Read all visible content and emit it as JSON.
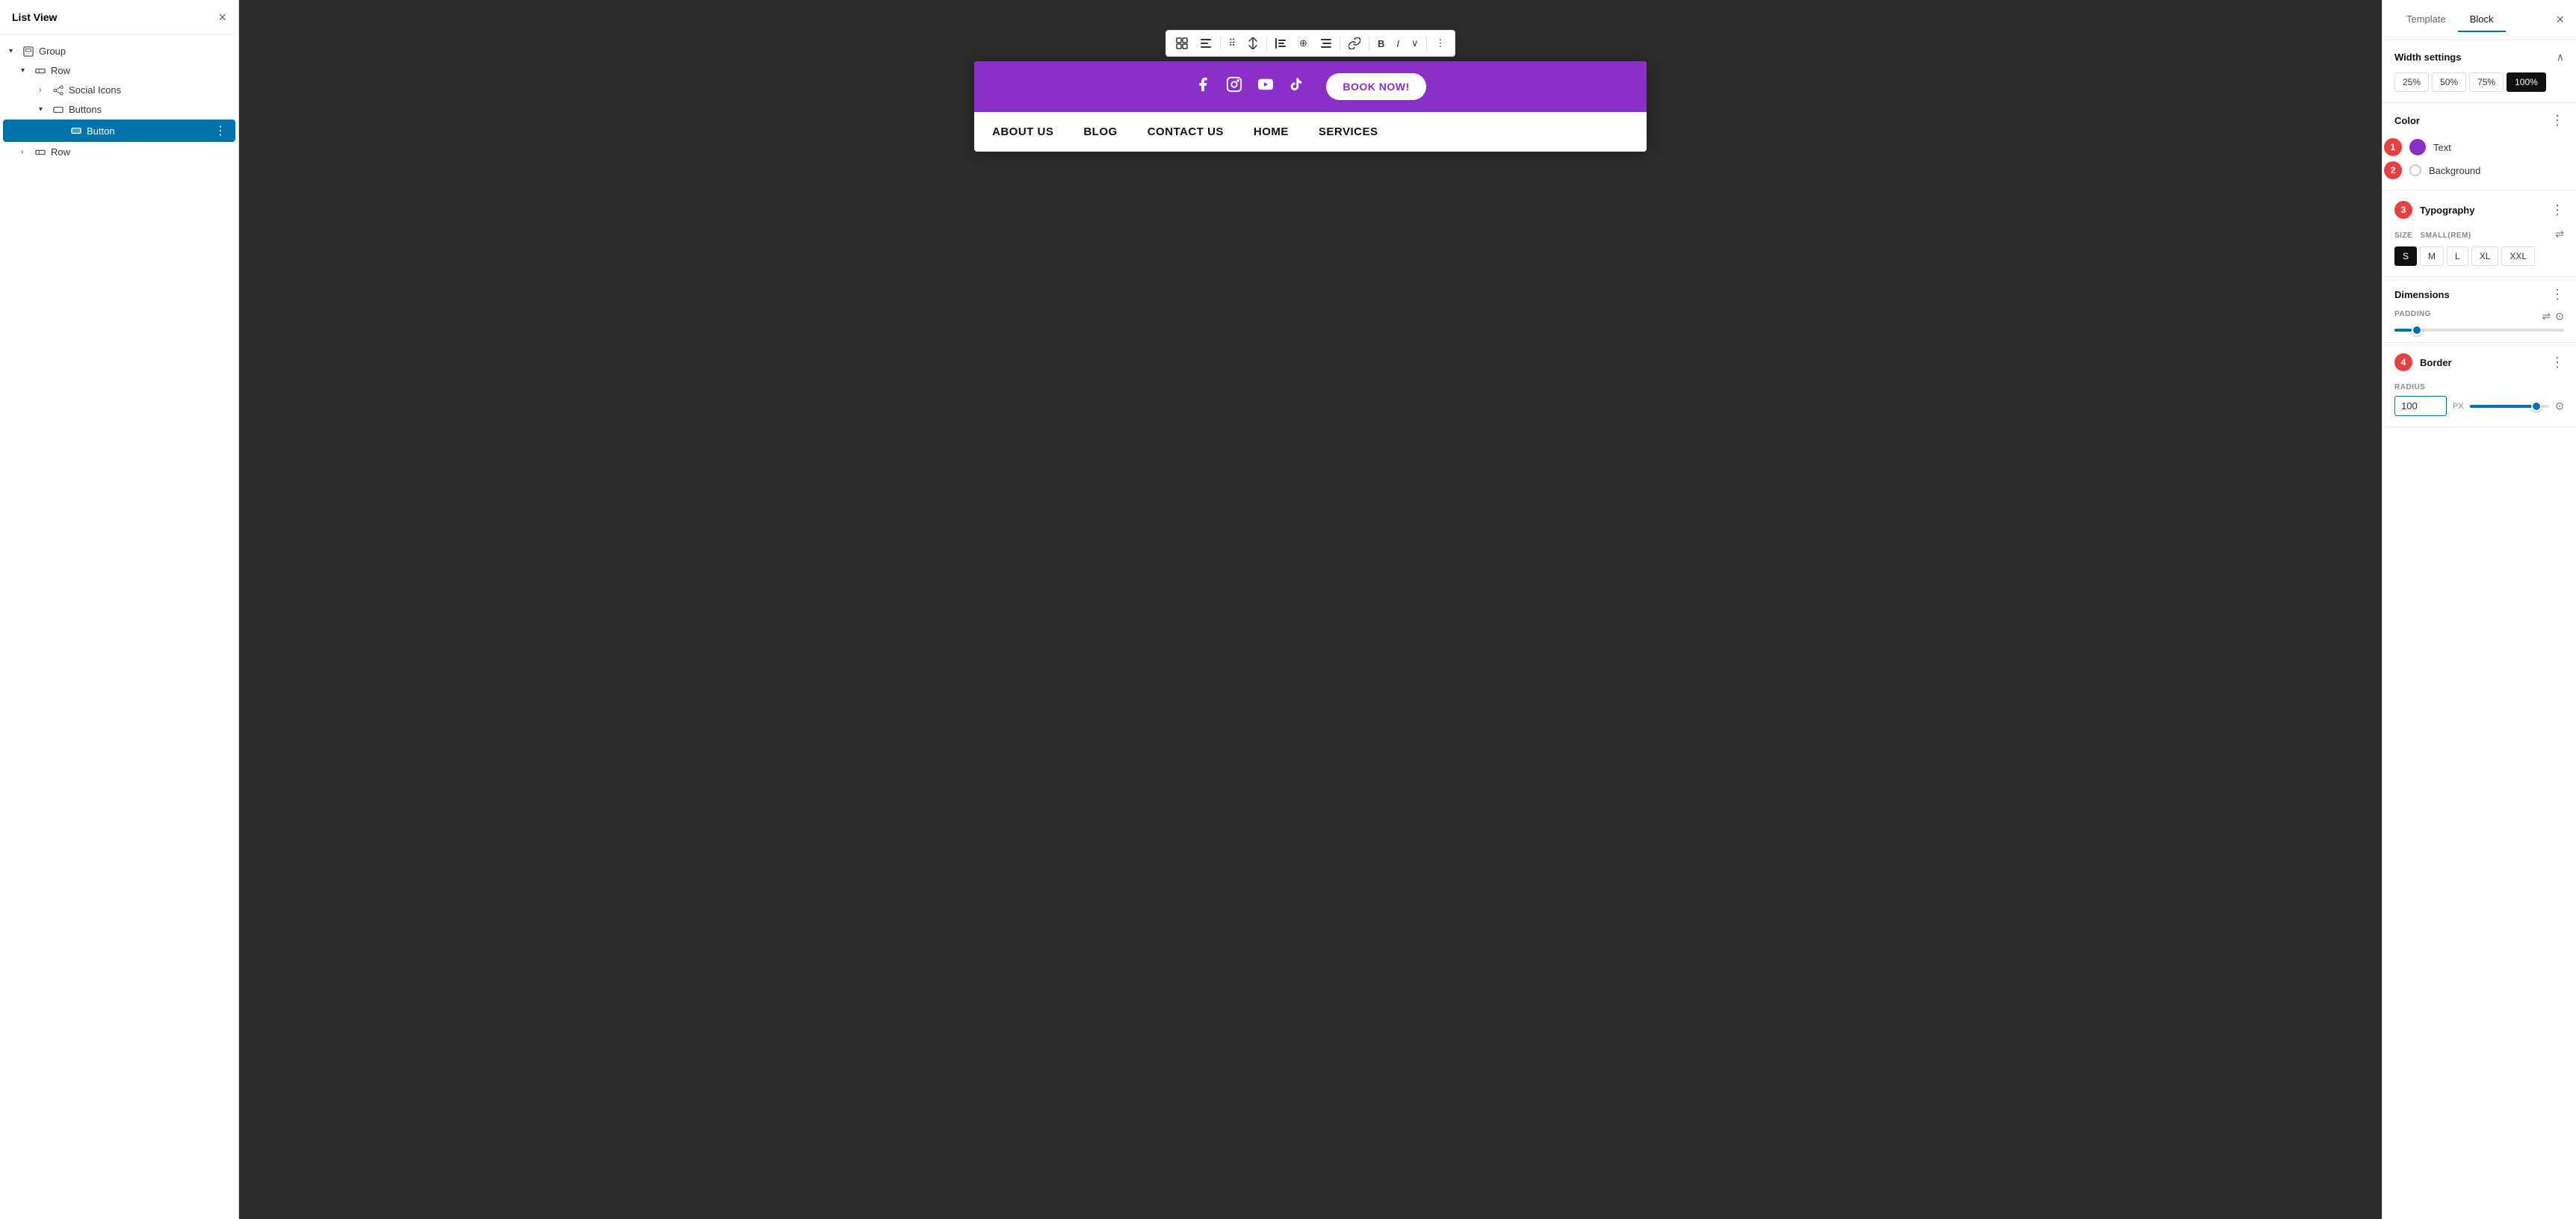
{
  "leftPanel": {
    "title": "List View",
    "closeLabel": "×",
    "tree": [
      {
        "id": "group",
        "label": "Group",
        "icon": "group",
        "indent": 0,
        "expanded": true,
        "hasArrow": true
      },
      {
        "id": "row1",
        "label": "Row",
        "icon": "row",
        "indent": 1,
        "expanded": true,
        "hasArrow": true
      },
      {
        "id": "social-icons",
        "label": "Social Icons",
        "icon": "social",
        "indent": 2,
        "expanded": false,
        "hasArrow": true
      },
      {
        "id": "buttons",
        "label": "Buttons",
        "icon": "buttons",
        "indent": 2,
        "expanded": true,
        "hasArrow": true
      },
      {
        "id": "button",
        "label": "Button",
        "icon": "button",
        "indent": 3,
        "selected": true,
        "hasArrow": false
      },
      {
        "id": "row2",
        "label": "Row",
        "icon": "row",
        "indent": 1,
        "expanded": false,
        "hasArrow": true
      }
    ]
  },
  "canvas": {
    "toolbar": {
      "buttons": [
        {
          "name": "toggle-view",
          "icon": "⊞"
        },
        {
          "name": "text-align-left",
          "icon": "▤"
        },
        {
          "name": "drag-handle",
          "icon": "⠿"
        },
        {
          "name": "arrow-up-down",
          "icon": "⇅"
        },
        {
          "name": "align-left",
          "icon": "⫷"
        },
        {
          "name": "align-center",
          "icon": "⊕"
        },
        {
          "name": "align-right",
          "icon": "≡"
        },
        {
          "name": "link",
          "icon": "🔗"
        },
        {
          "name": "bold",
          "icon": "B",
          "style": "bold"
        },
        {
          "name": "italic",
          "icon": "I",
          "style": "italic"
        },
        {
          "name": "more-text",
          "icon": "∨"
        },
        {
          "name": "overflow",
          "icon": "⋮"
        }
      ]
    },
    "socialBar": {
      "background": "#8b2fc9",
      "icons": [
        "facebook",
        "instagram",
        "youtube",
        "tiktok"
      ],
      "bookButton": "BOOK NOW!"
    },
    "navBar": {
      "items": [
        "ABOUT US",
        "BLOG",
        "CONTACT US",
        "HOME",
        "SERVICES"
      ]
    }
  },
  "rightPanel": {
    "tabs": [
      {
        "label": "Template",
        "active": false
      },
      {
        "label": "Block",
        "active": true
      }
    ],
    "closeLabel": "×",
    "widthSettings": {
      "title": "Width settings",
      "options": [
        "25%",
        "50%",
        "75%",
        "100%"
      ],
      "active": "100%"
    },
    "color": {
      "title": "Color",
      "options": [
        {
          "label": "Text",
          "type": "filled",
          "selected": true
        },
        {
          "label": "Background",
          "type": "outline",
          "selected": false
        }
      ],
      "badges": [
        "1",
        "2"
      ]
    },
    "typography": {
      "title": "Typography",
      "badge": "3",
      "sizeLabel": "SIZE",
      "sizeUnit": "SMALL(REM)",
      "sizes": [
        "S",
        "M",
        "L",
        "XL",
        "XXL"
      ],
      "activeSize": "S"
    },
    "dimensions": {
      "title": "Dimensions",
      "paddingLabel": "PADDING",
      "paddingValue": 5
    },
    "border": {
      "title": "Border",
      "badge": "4",
      "radiusLabel": "RADIUS",
      "radiusValue": "100",
      "radiusUnit": "PX"
    }
  }
}
